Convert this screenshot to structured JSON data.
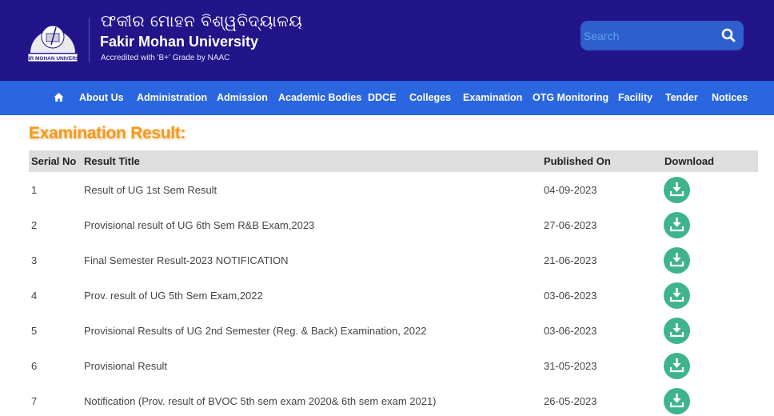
{
  "header": {
    "university_name_odia": "ଫକୀର ମୋହନ ବିଶ୍ୱବିଦ୍ୟାଳୟ",
    "university_name": "Fakir Mohan University",
    "accreditation": "Accredited with 'B+' Grade by NAAC",
    "logo_text": "FAKIR MOHAN UNIVERSITY",
    "search": {
      "placeholder": "Search",
      "value": ""
    }
  },
  "nav": {
    "items": [
      {
        "label": "About Us"
      },
      {
        "label": "Administration"
      },
      {
        "label": "Admission"
      },
      {
        "label": "Academic Bodies"
      },
      {
        "label": "DDCE"
      },
      {
        "label": "Colleges"
      },
      {
        "label": "Examination"
      },
      {
        "label": "OTG Monitoring"
      },
      {
        "label": "Facility"
      },
      {
        "label": "Tender"
      },
      {
        "label": "Notices"
      }
    ]
  },
  "page": {
    "title": "Examination Result:",
    "columns": [
      "Serial No",
      "Result Title",
      "Published On",
      "Download"
    ],
    "rows": [
      {
        "serial": "1",
        "title": "Result of UG 1st Sem Result",
        "published": "04-09-2023"
      },
      {
        "serial": "2",
        "title": "Provisional result of UG 6th Sem R&B Exam,2023",
        "published": "27-06-2023"
      },
      {
        "serial": "3",
        "title": "Final Semester Result-2023 NOTIFICATION",
        "published": "21-06-2023"
      },
      {
        "serial": "4",
        "title": "Prov. result of UG 5th Sem Exam,2022",
        "published": "03-06-2023"
      },
      {
        "serial": "5",
        "title": "Provisional Results of UG 2nd Semester (Reg. & Back) Examination, 2022",
        "published": "03-06-2023"
      },
      {
        "serial": "6",
        "title": "Provisional Result",
        "published": "31-05-2023"
      },
      {
        "serial": "7",
        "title": "Notification (Prov. result of BVOC 5th sem exam 2020& 6th sem exam 2021)",
        "published": "26-05-2023"
      }
    ]
  },
  "colors": {
    "header_bg": "#22158a",
    "nav_bg": "#2a66df",
    "title_orange": "#f19a1f",
    "download_green": "#3fb48c"
  }
}
